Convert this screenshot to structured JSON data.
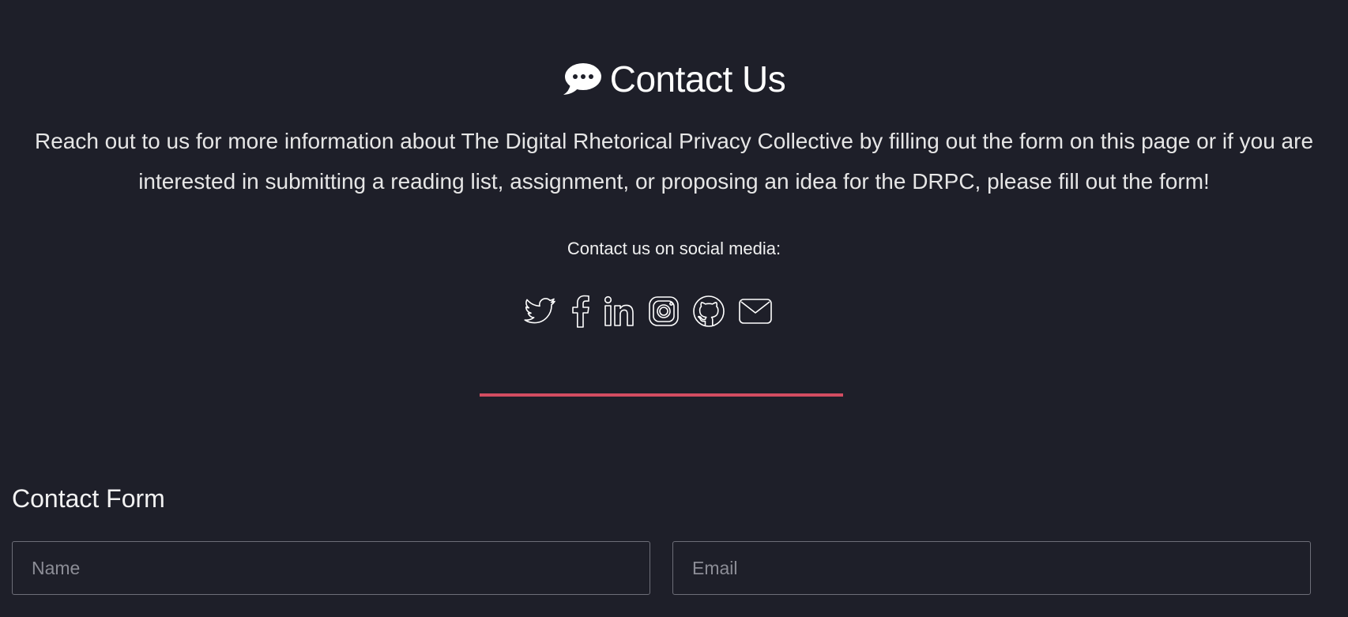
{
  "header": {
    "icon": "speech-bubble-icon",
    "title": "Contact Us"
  },
  "intro": {
    "line1": "Reach out to us for more information about The Digital Rhetorical Privacy Collective by filling out the form on this page or if you are",
    "line2": "interested in submitting a reading list, assignment, or proposing an idea for the DRPC, please fill out the form!"
  },
  "social": {
    "label": "Contact us on social media:",
    "icons": [
      "twitter-icon",
      "facebook-icon",
      "linkedin-icon",
      "instagram-icon",
      "github-icon",
      "email-icon"
    ]
  },
  "colors": {
    "background": "#1e1f29",
    "accent": "#d34d61",
    "text": "#ffffff",
    "field_border": "#6d6e78"
  },
  "form": {
    "title": "Contact Form",
    "name_placeholder": "Name",
    "email_placeholder": "Email"
  }
}
